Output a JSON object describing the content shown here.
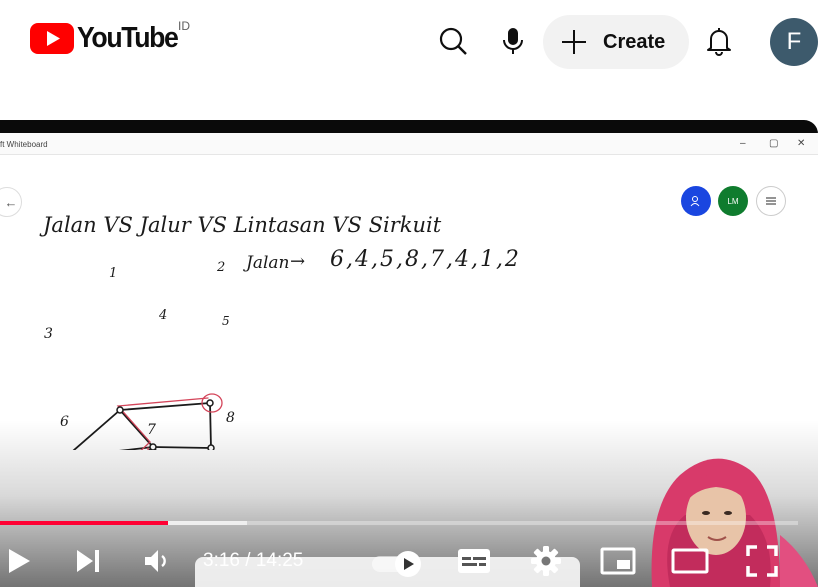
{
  "header": {
    "logo_text": "YouTube",
    "region": "ID",
    "create_label": "Create",
    "avatar_initial": "F",
    "icons": [
      "search-icon",
      "microphone-icon",
      "plus-icon",
      "notifications-bell-icon"
    ]
  },
  "video": {
    "app_title": "ft Whiteboard",
    "window_controls": [
      "–",
      "▢",
      "✕"
    ],
    "participants": [
      {
        "initials": "",
        "color": "#1a46e0"
      },
      {
        "initials": "LM",
        "color": "#0f7c2e"
      }
    ],
    "whiteboard": {
      "heading": "Jalan VS Jalur VS Lintasan VS Sirkuit",
      "jalan_label": "Jalan",
      "sequence": "6,4,5,8,7,4,1,2",
      "node_labels": [
        "1",
        "2",
        "3",
        "4",
        "5",
        "6",
        "7",
        "8"
      ]
    },
    "player": {
      "current_time": "3:16",
      "separator": "/",
      "duration": "14:25",
      "progress": 0.21,
      "buffered": 0.31,
      "colors": {
        "played": "#ff0033"
      },
      "controls": [
        "play-icon",
        "next-icon",
        "volume-icon",
        "autoplay-toggle",
        "subtitles-icon",
        "settings-gear-icon",
        "miniplayer-icon",
        "theater-mode-icon",
        "fullscreen-icon"
      ]
    }
  }
}
